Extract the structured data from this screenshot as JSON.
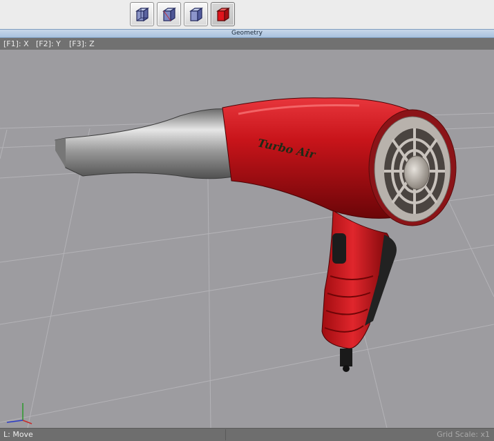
{
  "toolbar": {
    "buttons": [
      {
        "icon": "wireframe-cube-icon",
        "active": false
      },
      {
        "icon": "shaded-wireframe-cube-icon",
        "active": false
      },
      {
        "icon": "flat-shaded-cube-icon",
        "active": false
      },
      {
        "icon": "textured-cube-icon",
        "active": true
      }
    ]
  },
  "panel": {
    "title": "Geometry"
  },
  "axis_hints": {
    "x": "[F1]: X",
    "y": "[F2]: Y",
    "z": "[F3]: Z"
  },
  "viewport": {
    "model_label": "Turbo Air",
    "colors": {
      "body": "#c8141a",
      "nozzle": "#a7a7a7",
      "grid": "#b9b8bc",
      "background": "#9d9ca0"
    }
  },
  "status": {
    "mode": "L: Move",
    "grid_scale": "Grid Scale: x1"
  }
}
